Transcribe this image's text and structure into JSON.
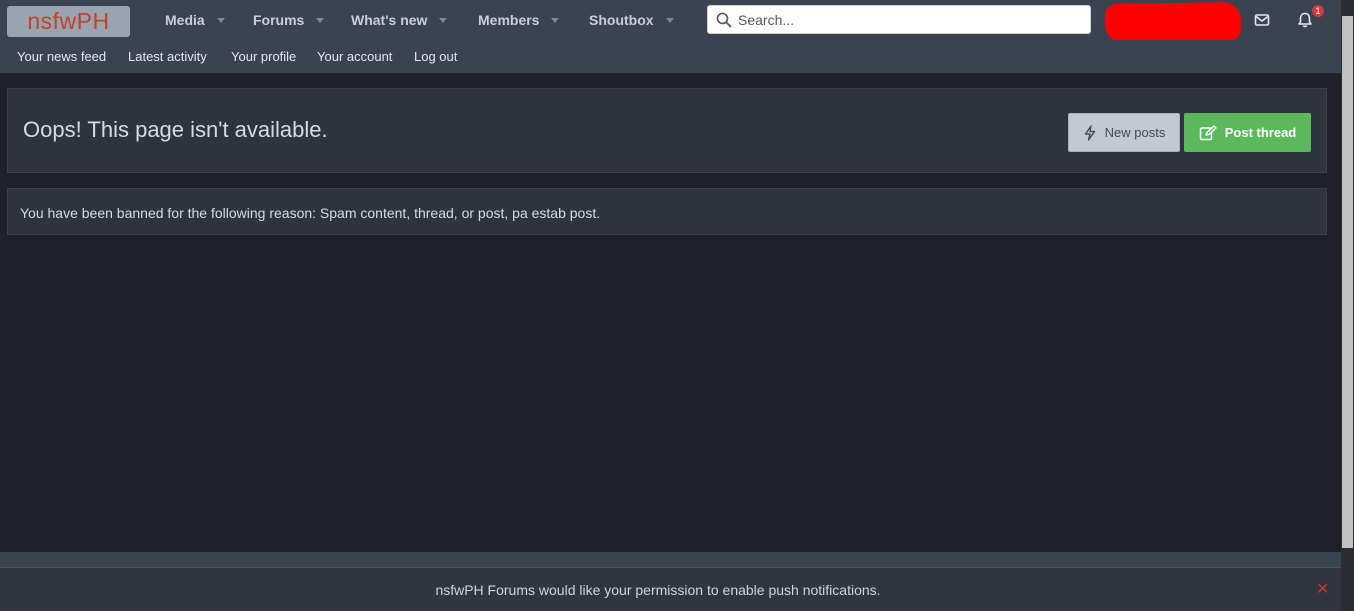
{
  "header": {
    "logo_text": "nsfwPH",
    "nav": [
      {
        "label": "Media"
      },
      {
        "label": "Forums"
      },
      {
        "label": "What's new"
      },
      {
        "label": "Members"
      },
      {
        "label": "Shoutbox"
      }
    ],
    "search_placeholder": "Search...",
    "notification_count": "1"
  },
  "subnav": {
    "items": [
      "Your news feed",
      "Latest activity",
      "Your profile",
      "Your account",
      "Log out"
    ]
  },
  "main": {
    "title": "Oops! This page isn't available.",
    "new_posts_label": "New posts",
    "post_thread_label": "Post thread",
    "message": "You have been banned for the following reason: Spam content, thread, or post, pa estab post."
  },
  "push": {
    "message": "nsfwPH Forums would like your permission to enable push notifications.",
    "close_symbol": "✕"
  },
  "colors": {
    "header_bg": "#3b4250",
    "page_bg": "#1f2029",
    "post_thread_green": "#5cb85c",
    "logo_red": "#c0432d"
  },
  "icons": [
    "search-icon",
    "envelope-icon",
    "bell-icon",
    "bolt-icon",
    "edit-icon",
    "close-icon",
    "caret-down-icon"
  ]
}
